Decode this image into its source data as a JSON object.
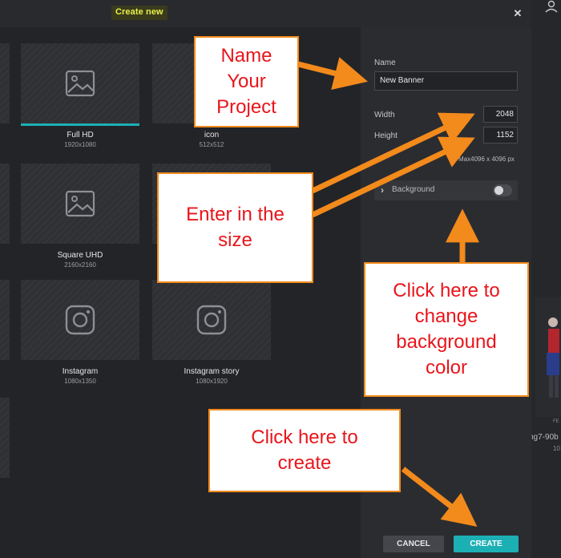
{
  "modal": {
    "title": "Create new",
    "close_symbol": "✕"
  },
  "templates": [
    {
      "name": "Full HD",
      "size": "1920x1080",
      "icon": "image-icon",
      "selected": true
    },
    {
      "name": "icon",
      "size": "512x512",
      "icon": "image-icon",
      "selected": false
    },
    {
      "name": "Square UHD",
      "size": "2160x2160",
      "icon": "image-icon",
      "selected": false
    },
    {
      "name": "Instagram",
      "size": "1080x1350",
      "icon": "instagram-icon",
      "selected": false
    },
    {
      "name": "Instagram story",
      "size": "1080x1920",
      "icon": "instagram-icon",
      "selected": false
    }
  ],
  "form": {
    "name_label": "Name",
    "name_value": "New Banner",
    "width_label": "Width",
    "width_value": "2048",
    "height_label": "Height",
    "height_value": "1152",
    "max_note": "Max4096 x 4096 px",
    "background_label": "Background",
    "background_enabled": false
  },
  "buttons": {
    "cancel": "CANCEL",
    "create": "CREATE"
  },
  "background_app": {
    "label_top": "FE",
    "label": "ng7-90b",
    "sub": "10"
  },
  "annotations": {
    "name_project": [
      "Name",
      "Your",
      "Project"
    ],
    "enter_size": [
      "Enter in the",
      "size"
    ],
    "background_color": [
      "Click here to",
      "change",
      "background",
      "color"
    ],
    "create": [
      "Click here to",
      "create"
    ]
  },
  "colors": {
    "accent": "#1cb0b5",
    "title_highlight": "#e9ef4a",
    "annotation_border": "#f28a1c",
    "annotation_text": "#e8151b"
  }
}
